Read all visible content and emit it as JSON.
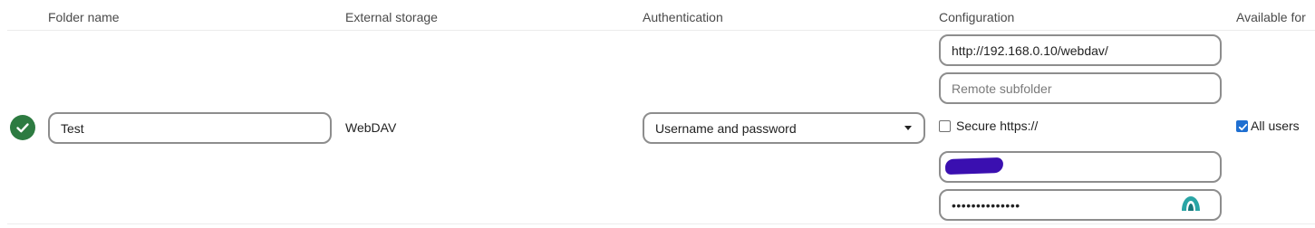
{
  "headers": {
    "folder_name": "Folder name",
    "external_storage": "External storage",
    "authentication": "Authentication",
    "configuration": "Configuration",
    "available_for": "Available for"
  },
  "row": {
    "status": "ok",
    "folder_name_value": "Test",
    "storage_type": "WebDAV",
    "auth_method": "Username and password",
    "config": {
      "url_value": "http://192.168.0.10/webdav/",
      "subfolder_placeholder": "Remote subfolder",
      "secure_label": "Secure https://",
      "secure_checked": false,
      "username_redacted": true,
      "password_mask": "••••••••••••••"
    },
    "available_for": {
      "label": "All users",
      "checked": true
    }
  },
  "colors": {
    "status_green": "#2d7b41",
    "checkbox_blue": "#1f6fd1",
    "redaction_purple": "#3a0fb0",
    "pw_icon_teal": "#2aa5a5",
    "field_border": "#8d8d8d"
  },
  "icons": {
    "status": "check-circle-icon",
    "select_caret": "caret-down-icon",
    "password_manager": "password-manager-icon"
  }
}
